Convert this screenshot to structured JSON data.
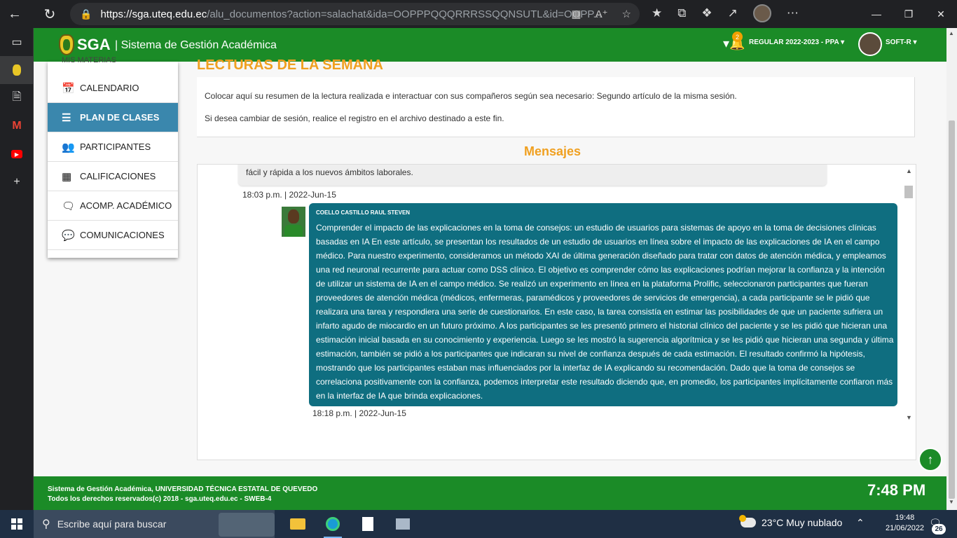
{
  "browser": {
    "url_host": "https://sga.uteq.edu.ec",
    "url_path": "/alu_documentos?action=salachat&ida=OOPPPQQQRRRSSQQNSUTL&id=OOPP..."
  },
  "header": {
    "brand": "SGA",
    "subtitle": "| Sistema de Gestión Académica",
    "notification_count": "2",
    "period": "REGULAR 2022-2023 - PPA",
    "user": "SOFT-R"
  },
  "menu": {
    "cut_item": "MIS MATERIAS",
    "items": [
      {
        "label": "CALENDARIO",
        "icon": "calendar-icon"
      },
      {
        "label": "PLAN DE CLASES",
        "icon": "list-icon"
      },
      {
        "label": "PARTICIPANTES",
        "icon": "users-icon"
      },
      {
        "label": "CALIFICACIONES",
        "icon": "table-icon"
      },
      {
        "label": "ACOMP. ACADÉMICO",
        "icon": "chat-icon"
      },
      {
        "label": "COMUNICACIONES",
        "icon": "comment-icon"
      }
    ]
  },
  "content": {
    "section_title": "LECTURAS DE LA SEMANA",
    "info_line1": "Colocar aquí su resumen de la lectura realizada e interactuar con sus compañeros según sea necesario: Segundo artículo de la misma sesión.",
    "info_line2": "Si desea cambiar de sesión, realice el registro en el archivo destinado a este fin.",
    "messages_title": "Mensajes"
  },
  "chat": {
    "prev_text": "fácil y rápida a los nuevos ámbitos laborales.",
    "prev_time": "18:03 p.m. | 2022-Jun-15",
    "sender": "COELLO CASTILLO RAUL STEVEN",
    "message": "Comprender el impacto de las explicaciones en la toma de consejos: un estudio de usuarios para sistemas de apoyo en la toma de decisiones clínicas basadas en IA En este artículo, se presentan los resultados de un estudio de usuarios en línea sobre el impacto de las explicaciones de IA en el campo médico. Para nuestro experimento, consideramos un método XAI de última generación diseñado para tratar con datos de atención médica, y empleamos una red neuronal recurrente para actuar como DSS clínico. El objetivo es comprender cómo las explicaciones podrían mejorar la confianza y la intención de utilizar un sistema de IA en el campo médico. Se realizó un experimento en línea en la plataforma Prolific, seleccionaron participantes que fueran proveedores de atención médica (médicos, enfermeras, paramédicos y proveedores de servicios de emergencia), a cada participante se le pidió que realizara una tarea y respondiera una serie de cuestionarios. En este caso, la tarea consistía en estimar las posibilidades de que un paciente sufriera un infarto agudo de miocardio en un futuro próximo. A los participantes se les presentó primero el historial clínico del paciente y se les pidió que hicieran una estimación inicial basada en su conocimiento y experiencia. Luego se les mostró la sugerencia algorítmica y se les pidió que hicieran una segunda y última estimación, también se pidió a los participantes que indicaran su nivel de confianza después de cada estimación. El resultado confirmó la hipótesis, mostrando que los participantes estaban mas influenciados por la interfaz de IA explicando su recomendación. Dado que la toma de consejos se correlaciona positivamente con la confianza, podemos interpretar este resultado diciendo que, en promedio, los participantes implícitamente confiaron más en la interfaz de IA que brinda explicaciones.",
    "time": "18:18 p.m. | 2022-Jun-15"
  },
  "footer": {
    "line1": "Sistema de Gestión Académica, UNIVERSIDAD TÉCNICA ESTATAL DE QUEVEDO",
    "line2": "Todos los derechos reservados(c) 2018 - sga.uteq.edu.ec - SWEB-4",
    "clock": "7:48 PM"
  },
  "taskbar": {
    "search_placeholder": "Escribe aquí para buscar",
    "weather": "23°C  Muy nublado",
    "time": "19:48",
    "date": "21/06/2022",
    "notifications": "26"
  },
  "colors": {
    "green": "#1b8b27",
    "orange": "#f0a020",
    "bubble": "#0f6e80",
    "active_menu": "#3a87ad"
  }
}
